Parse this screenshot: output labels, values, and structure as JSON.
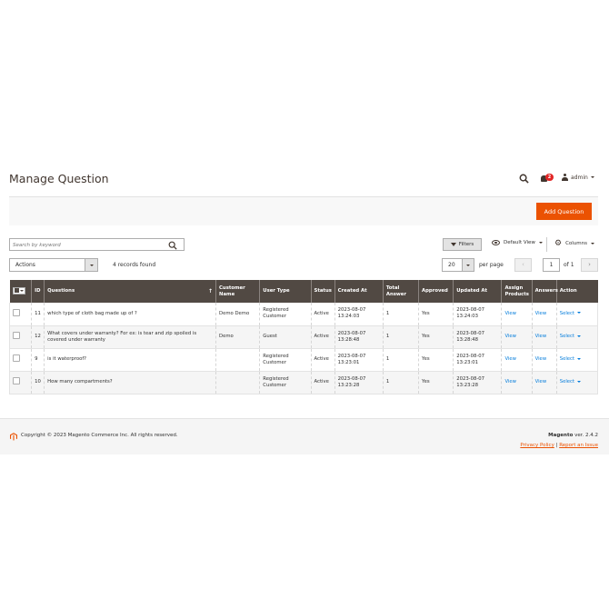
{
  "page": {
    "title": "Manage Question"
  },
  "header": {
    "notifications_count": "2",
    "user_label": "admin"
  },
  "toolbar": {
    "add_button_label": "Add Question",
    "search_placeholder": "Search by keyword",
    "filters_label": "Filters",
    "view_label": "Default View",
    "columns_label": "Columns",
    "actions_label": "Actions",
    "records_found": "4 records found",
    "per_page_value": "20",
    "per_page_label": "per page",
    "current_page": "1",
    "page_of": "of 1"
  },
  "grid": {
    "columns": [
      "ID",
      "Questions",
      "Customer Name",
      "User Type",
      "Status",
      "Created At",
      "Total Answer",
      "Approved",
      "Updated At",
      "Assign Products",
      "Answers",
      "Action"
    ],
    "rows": [
      {
        "id": "11",
        "question": "which type of cloth bag made up of ?",
        "customer": "Demo Demo",
        "user_type": "Registered Customer",
        "status": "Active",
        "created": "2023-08-07 13:24:03",
        "total_answer": "1",
        "approved": "Yes",
        "updated": "2023-08-07 13:24:03",
        "assign": "View",
        "answers": "View",
        "action": "Select"
      },
      {
        "id": "12",
        "question": "What covers under warranty? For ex: is tear and zip spoiled is covered under warranty",
        "customer": "Demo",
        "user_type": "Guest",
        "status": "Active",
        "created": "2023-08-07 13:28:48",
        "total_answer": "1",
        "approved": "Yes",
        "updated": "2023-08-07 13:28:48",
        "assign": "View",
        "answers": "View",
        "action": "Select"
      },
      {
        "id": "9",
        "question": "is it waterproof?",
        "customer": "",
        "user_type": "Registered Customer",
        "status": "Active",
        "created": "2023-08-07 13:23:01",
        "total_answer": "1",
        "approved": "Yes",
        "updated": "2023-08-07 13:23:01",
        "assign": "View",
        "answers": "View",
        "action": "Select"
      },
      {
        "id": "10",
        "question": "How many compartments?",
        "customer": "",
        "user_type": "Registered Customer",
        "status": "Active",
        "created": "2023-08-07 13:23:28",
        "total_answer": "1",
        "approved": "Yes",
        "updated": "2023-08-07 13:23:28",
        "assign": "View",
        "answers": "View",
        "action": "Select"
      }
    ]
  },
  "footer": {
    "copyright": "Copyright © 2023 Magento Commerce Inc. All rights reserved.",
    "brand": "Magento",
    "version": " ver. 2.4.2",
    "privacy_link": "Privacy Policy",
    "separator": "|",
    "report_link": "Report an Issue"
  },
  "colors": {
    "accent": "#eb5202",
    "header_bg": "#514943",
    "link": "#007bdb",
    "badge": "#e22626"
  }
}
